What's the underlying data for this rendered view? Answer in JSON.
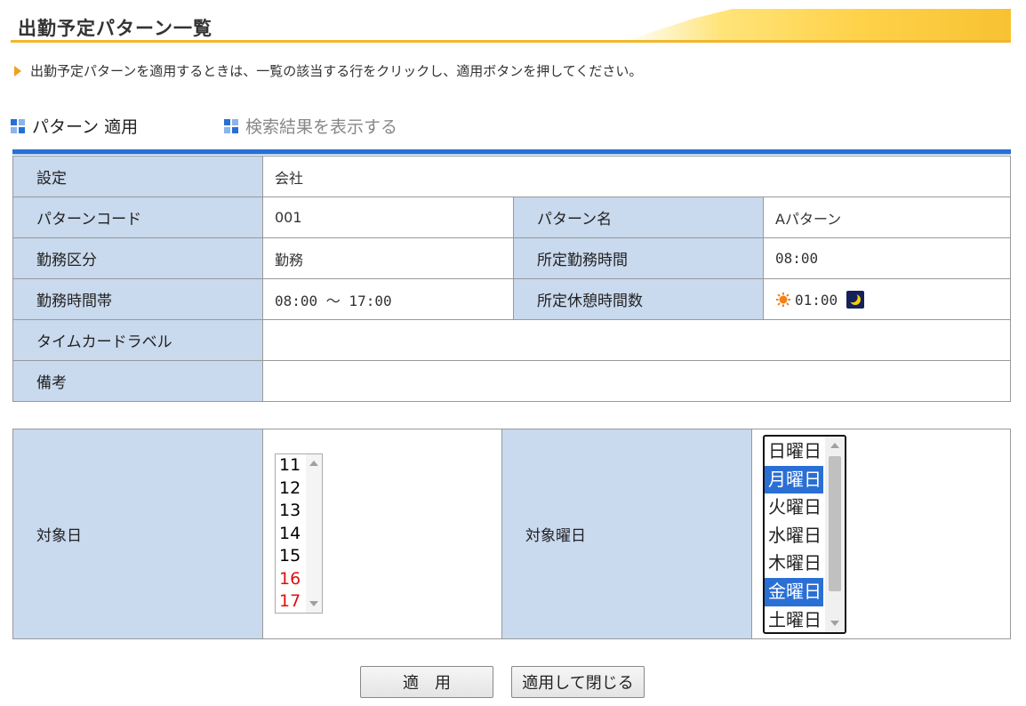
{
  "page": {
    "title": "出勤予定パターン一覧",
    "instruction": "出勤予定パターンを適用するときは、一覧の該当する行をクリックし、適用ボタンを押してください。"
  },
  "tabs": [
    {
      "label": "パターン 適用",
      "active": true
    },
    {
      "label": "検索結果を表示する",
      "active": false
    }
  ],
  "info": {
    "setting_label": "設定",
    "setting_value": "会社",
    "code_label": "パターンコード",
    "code_value": "001",
    "name_label": "パターン名",
    "name_value": "Aパターン",
    "category_label": "勤務区分",
    "category_value": "勤務",
    "scheduled_hours_label": "所定勤務時間",
    "scheduled_hours_value": "08:00",
    "time_range_label": "勤務時間帯",
    "time_range_value": "08:00 〜 17:00",
    "break_label": "所定休憩時間数",
    "break_value": "01:00",
    "timecard_label": "タイムカードラベル",
    "timecard_value": "",
    "note_label": "備考",
    "note_value": ""
  },
  "target": {
    "day_label": "対象日",
    "days": [
      {
        "text": "11",
        "color": "#000000"
      },
      {
        "text": "12",
        "color": "#000000"
      },
      {
        "text": "13",
        "color": "#000000"
      },
      {
        "text": "14",
        "color": "#000000"
      },
      {
        "text": "15",
        "color": "#000000"
      },
      {
        "text": "16",
        "color": "#e01010"
      },
      {
        "text": "17",
        "color": "#e01010"
      }
    ],
    "weekday_label": "対象曜日",
    "weekdays": [
      {
        "text": "日曜日",
        "selected": false
      },
      {
        "text": "月曜日",
        "selected": true
      },
      {
        "text": "火曜日",
        "selected": false
      },
      {
        "text": "水曜日",
        "selected": false
      },
      {
        "text": "木曜日",
        "selected": false
      },
      {
        "text": "金曜日",
        "selected": true
      },
      {
        "text": "土曜日",
        "selected": false
      }
    ]
  },
  "buttons": {
    "apply_label": "適　用",
    "apply_close_label": "適用して閉じる"
  },
  "colors": {
    "accent_blue": "#2a6fd4",
    "label_bg": "#c9d9ee",
    "title_accent": "#f2b62c",
    "weekend_red": "#e01010"
  },
  "icons": {
    "instruction_arrow": "triangle-right-icon",
    "tab_icon": "grid-icon",
    "break_day": "sun-icon",
    "break_night": "moon-icon"
  }
}
